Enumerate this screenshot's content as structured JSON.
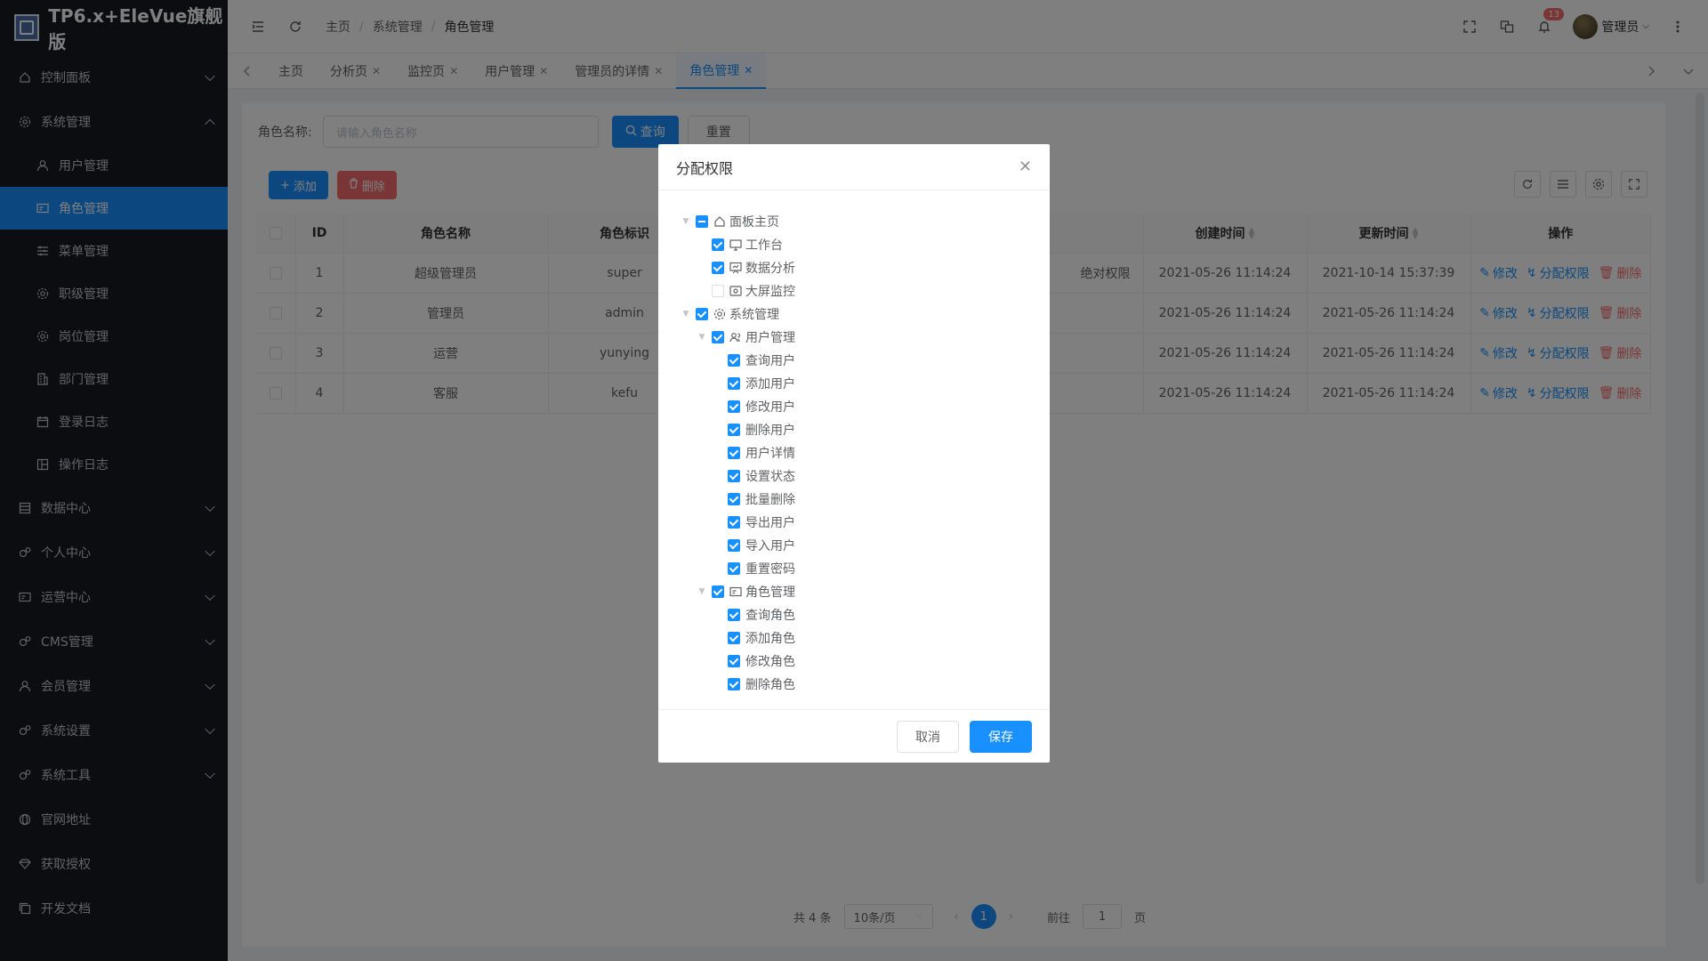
{
  "app": {
    "title": "TP6.x+EleVue旗舰版"
  },
  "sidebar": {
    "items": [
      {
        "label": "控制面板",
        "icon": "home-icon"
      },
      {
        "label": "系统管理",
        "icon": "gear-icon",
        "expanded": true
      },
      {
        "label": "用户管理",
        "icon": "user-icon",
        "sub": true
      },
      {
        "label": "角色管理",
        "icon": "card-icon",
        "sub": true,
        "active": true
      },
      {
        "label": "菜单管理",
        "icon": "sliders-icon",
        "sub": true
      },
      {
        "label": "职级管理",
        "icon": "gear-icon",
        "sub": true
      },
      {
        "label": "岗位管理",
        "icon": "gear-icon",
        "sub": true
      },
      {
        "label": "部门管理",
        "icon": "building-icon",
        "sub": true
      },
      {
        "label": "登录日志",
        "icon": "calendar-icon",
        "sub": true
      },
      {
        "label": "操作日志",
        "icon": "layout-icon",
        "sub": true
      },
      {
        "label": "数据中心",
        "icon": "database-icon"
      },
      {
        "label": "个人中心",
        "icon": "gears-icon"
      },
      {
        "label": "运营中心",
        "icon": "card-icon"
      },
      {
        "label": "CMS管理",
        "icon": "gears-icon"
      },
      {
        "label": "会员管理",
        "icon": "user-icon"
      },
      {
        "label": "系统设置",
        "icon": "gears-icon"
      },
      {
        "label": "系统工具",
        "icon": "gears-icon"
      },
      {
        "label": "官网地址",
        "icon": "globe-icon"
      },
      {
        "label": "获取授权",
        "icon": "diamond-icon"
      },
      {
        "label": "开发文档",
        "icon": "copy-icon"
      }
    ]
  },
  "header": {
    "breadcrumb": [
      "主页",
      "系统管理",
      "角色管理"
    ],
    "notification_count": "13",
    "user_name": "管理员"
  },
  "tabs": [
    {
      "label": "主页",
      "closable": false
    },
    {
      "label": "分析页",
      "closable": true
    },
    {
      "label": "监控页",
      "closable": true
    },
    {
      "label": "用户管理",
      "closable": true
    },
    {
      "label": "管理员的详情",
      "closable": true
    },
    {
      "label": "角色管理",
      "closable": true,
      "active": true
    }
  ],
  "search": {
    "label": "角色名称:",
    "placeholder": "请输入角色名称",
    "query_label": "查询",
    "reset_label": "重置"
  },
  "toolbar": {
    "add_label": "添加",
    "delete_label": "删除"
  },
  "table": {
    "headers": {
      "id": "ID",
      "name": "角色名称",
      "code": "角色标识",
      "created": "创建时间",
      "updated": "更新时间",
      "ops": "操作"
    },
    "rows": [
      {
        "id": "1",
        "name": "超级管理员",
        "code": "super",
        "note": "绝对权限",
        "created": "2021-05-26 11:14:24",
        "updated": "2021-10-14 15:37:39"
      },
      {
        "id": "2",
        "name": "管理员",
        "code": "admin",
        "note": "",
        "created": "2021-05-26 11:14:24",
        "updated": "2021-05-26 11:14:24"
      },
      {
        "id": "3",
        "name": "运营",
        "code": "yunying",
        "note": "",
        "created": "2021-05-26 11:14:24",
        "updated": "2021-05-26 11:14:24"
      },
      {
        "id": "4",
        "name": "客服",
        "code": "kefu",
        "note": "",
        "created": "2021-05-26 11:14:24",
        "updated": "2021-05-26 11:14:24"
      }
    ],
    "op_edit": "修改",
    "op_assign": "分配权限",
    "op_delete": "删除"
  },
  "pagination": {
    "total": "共 4 条",
    "page_size": "10条/页",
    "current": "1",
    "goto_prefix": "前往",
    "goto_value": "1",
    "goto_suffix": "页"
  },
  "modal": {
    "title": "分配权限",
    "tree": [
      {
        "label": "面板主页",
        "level": 0,
        "state": "half",
        "caret": true,
        "icon": "home-icon"
      },
      {
        "label": "工作台",
        "level": 1,
        "state": "checked",
        "icon": "monitor-icon"
      },
      {
        "label": "数据分析",
        "level": 1,
        "state": "checked",
        "icon": "chart-icon"
      },
      {
        "label": "大屏监控",
        "level": 1,
        "state": "empty",
        "icon": "screen-icon"
      },
      {
        "label": "系统管理",
        "level": 0,
        "state": "checked",
        "caret": true,
        "icon": "gear-icon"
      },
      {
        "label": "用户管理",
        "level": 1,
        "state": "checked",
        "caret": true,
        "icon": "users-icon"
      },
      {
        "label": "查询用户",
        "level": 2,
        "state": "checked"
      },
      {
        "label": "添加用户",
        "level": 2,
        "state": "checked"
      },
      {
        "label": "修改用户",
        "level": 2,
        "state": "checked"
      },
      {
        "label": "删除用户",
        "level": 2,
        "state": "checked"
      },
      {
        "label": "用户详情",
        "level": 2,
        "state": "checked"
      },
      {
        "label": "设置状态",
        "level": 2,
        "state": "checked"
      },
      {
        "label": "批量删除",
        "level": 2,
        "state": "checked"
      },
      {
        "label": "导出用户",
        "level": 2,
        "state": "checked"
      },
      {
        "label": "导入用户",
        "level": 2,
        "state": "checked"
      },
      {
        "label": "重置密码",
        "level": 2,
        "state": "checked"
      },
      {
        "label": "角色管理",
        "level": 1,
        "state": "checked",
        "caret": true,
        "icon": "card-icon"
      },
      {
        "label": "查询角色",
        "level": 2,
        "state": "checked"
      },
      {
        "label": "添加角色",
        "level": 2,
        "state": "checked"
      },
      {
        "label": "修改角色",
        "level": 2,
        "state": "checked"
      },
      {
        "label": "删除角色",
        "level": 2,
        "state": "checked"
      }
    ],
    "cancel_label": "取消",
    "save_label": "保存"
  },
  "colors": {
    "primary": "#1890ff",
    "danger": "#f56c6c",
    "sidebar_bg": "#191a23"
  }
}
